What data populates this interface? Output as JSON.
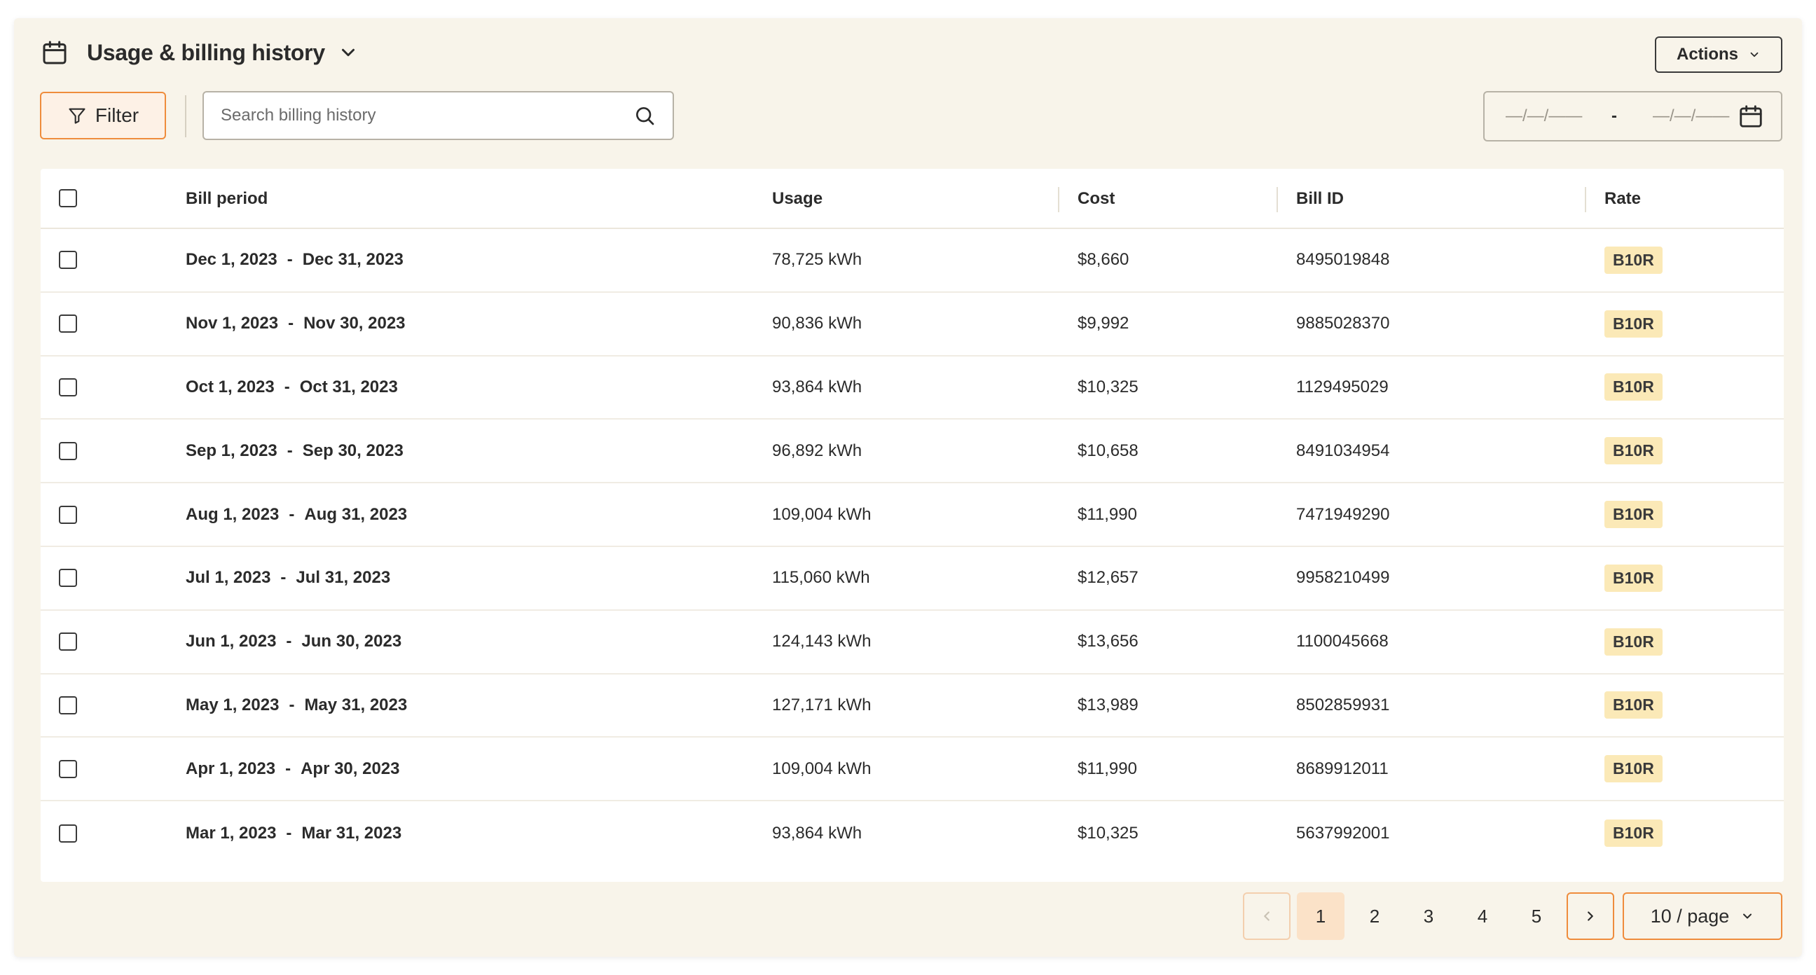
{
  "header": {
    "title": "Usage & billing history",
    "actions_label": "Actions"
  },
  "toolbar": {
    "filter_label": "Filter",
    "search_placeholder": "Search billing history",
    "date_from_placeholder": "—/—/——",
    "date_separator": "-",
    "date_to_placeholder": "—/—/——"
  },
  "table": {
    "columns": {
      "period": "Bill period",
      "usage": "Usage",
      "cost": "Cost",
      "bill_id": "Bill ID",
      "rate": "Rate"
    },
    "rows": [
      {
        "start": "Dec 1, 2023",
        "end": "Dec 31, 2023",
        "usage": "78,725 kWh",
        "cost": "$8,660",
        "bill_id": "8495019848",
        "rate": "B10R"
      },
      {
        "start": "Nov 1, 2023",
        "end": "Nov 30, 2023",
        "usage": "90,836 kWh",
        "cost": "$9,992",
        "bill_id": "9885028370",
        "rate": "B10R"
      },
      {
        "start": "Oct 1, 2023",
        "end": "Oct 31, 2023",
        "usage": "93,864 kWh",
        "cost": "$10,325",
        "bill_id": "1129495029",
        "rate": "B10R"
      },
      {
        "start": "Sep 1, 2023",
        "end": "Sep 30, 2023",
        "usage": "96,892 kWh",
        "cost": "$10,658",
        "bill_id": "8491034954",
        "rate": "B10R"
      },
      {
        "start": "Aug 1, 2023",
        "end": "Aug 31, 2023",
        "usage": "109,004 kWh",
        "cost": "$11,990",
        "bill_id": "7471949290",
        "rate": "B10R"
      },
      {
        "start": "Jul 1, 2023",
        "end": "Jul 31, 2023",
        "usage": "115,060 kWh",
        "cost": "$12,657",
        "bill_id": "9958210499",
        "rate": "B10R"
      },
      {
        "start": "Jun 1, 2023",
        "end": "Jun 30, 2023",
        "usage": "124,143 kWh",
        "cost": "$13,656",
        "bill_id": "1100045668",
        "rate": "B10R"
      },
      {
        "start": "May 1, 2023",
        "end": "May 31, 2023",
        "usage": "127,171 kWh",
        "cost": "$13,989",
        "bill_id": "8502859931",
        "rate": "B10R"
      },
      {
        "start": "Apr 1, 2023",
        "end": "Apr 30, 2023",
        "usage": "109,004 kWh",
        "cost": "$11,990",
        "bill_id": "8689912011",
        "rate": "B10R"
      },
      {
        "start": "Mar 1, 2023",
        "end": "Mar 31, 2023",
        "usage": "93,864 kWh",
        "cost": "$10,325",
        "bill_id": "5637992001",
        "rate": "B10R"
      }
    ],
    "date_dash": "-"
  },
  "pagination": {
    "pages": [
      "1",
      "2",
      "3",
      "4",
      "5"
    ],
    "current_page": "1",
    "page_size_label": "10 / page"
  },
  "colors": {
    "background": "#f8f4ea",
    "accent": "#ef8c3c",
    "badge": "#fbe9b7"
  },
  "icons": {
    "header": "calendar-icon",
    "title_toggle": "chevron-down-icon",
    "filter": "filter-icon",
    "search": "search-icon",
    "date_picker": "calendar-icon"
  }
}
